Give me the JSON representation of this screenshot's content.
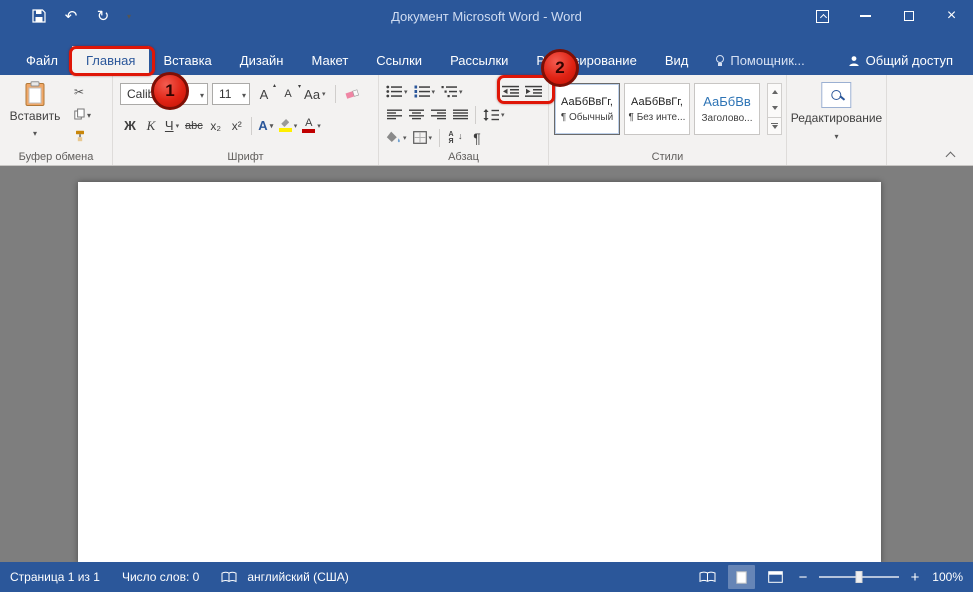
{
  "colors": {
    "accent": "#2b579a",
    "annotation_fill": "#e02314",
    "annotation_border": "#7d0f05",
    "ribbon_bg": "#f3f2f1",
    "document_bg": "#7e7e7e"
  },
  "title_bar": {
    "title": "Документ Microsoft Word - Word"
  },
  "tabs": {
    "file": "Файл",
    "home": "Главная",
    "insert": "Вставка",
    "design": "Дизайн",
    "layout": "Макет",
    "references": "Ссылки",
    "mailings": "Рассылки",
    "review": "Рецензирование",
    "view": "Вид",
    "assistant": "Помощник...",
    "share": "Общий доступ"
  },
  "ribbon": {
    "clipboard": {
      "label": "Буфер обмена",
      "paste": "Вставить"
    },
    "font": {
      "label": "Шрифт",
      "name": "Calibri",
      "size": "11",
      "bold": "Ж",
      "italic": "К",
      "underline": "Ч",
      "strikethrough": "abc",
      "subscript": "х₂",
      "superscript": "х²",
      "grow": "А",
      "shrink": "А",
      "change_case": "Аа",
      "text_effects": "А",
      "font_color_letter": "А"
    },
    "paragraph": {
      "label": "Абзац"
    },
    "styles": {
      "label": "Стили",
      "items": [
        {
          "preview": "АаБбВвГг,",
          "name": "¶ Обычный"
        },
        {
          "preview": "АаБбВвГг,",
          "name": "¶ Без инте..."
        },
        {
          "preview": "АаБбВв",
          "name": "Заголово..."
        }
      ]
    },
    "editing": {
      "label": "Редактирование"
    }
  },
  "status_bar": {
    "page": "Страница 1 из 1",
    "words": "Число слов: 0",
    "language": "английский (США)",
    "zoom": "100%"
  },
  "annotations": [
    {
      "number": "1"
    },
    {
      "number": "2"
    }
  ],
  "glyphs": {
    "undo": "↶",
    "redo": "↻",
    "scissors": "✂",
    "close": "×",
    "pilcrow": "¶",
    "minus": "−",
    "plus": "+",
    "sort_a": "А",
    "sort_z": "Я",
    "sort_arrow": "↓"
  }
}
